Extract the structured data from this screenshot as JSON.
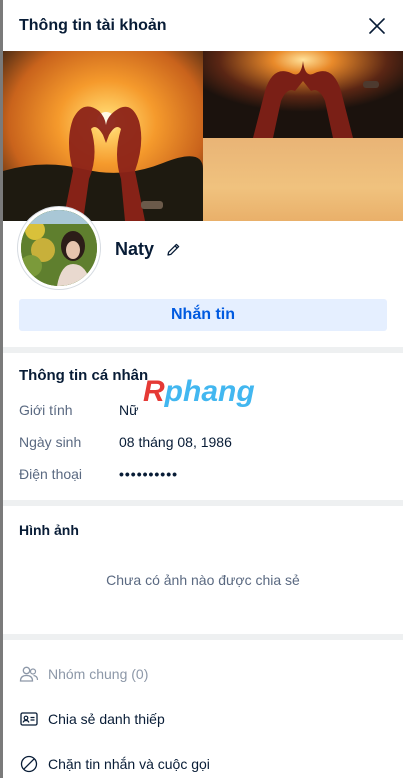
{
  "header": {
    "title": "Thông tin tài khoản"
  },
  "profile": {
    "name": "Naty"
  },
  "message_button": {
    "label": "Nhắn tin"
  },
  "personal_info": {
    "title": "Thông tin cá nhân",
    "rows": [
      {
        "label": "Giới tính",
        "value": "Nữ"
      },
      {
        "label": "Ngày sinh",
        "value": "08 tháng 08, 1986"
      },
      {
        "label": "Điện thoại",
        "value": "••••••••••"
      }
    ]
  },
  "watermark": {
    "first": "R",
    "rest": "phang"
  },
  "photos": {
    "title": "Hình ảnh",
    "empty_text": "Chưa có ảnh nào được chia sẻ"
  },
  "actions": [
    {
      "label": "Nhóm chung (0)",
      "icon": "group-icon",
      "disabled": true
    },
    {
      "label": "Chia sẻ danh thiếp",
      "icon": "contact-card-icon",
      "disabled": false
    },
    {
      "label": "Chặn tin nhắn và cuộc gọi",
      "icon": "block-icon",
      "disabled": false
    }
  ],
  "colors": {
    "accent": "#005ae0",
    "button_bg": "#e5efff",
    "divider": "#eef0f1",
    "text": "#081c36",
    "muted": "#5a6981"
  }
}
